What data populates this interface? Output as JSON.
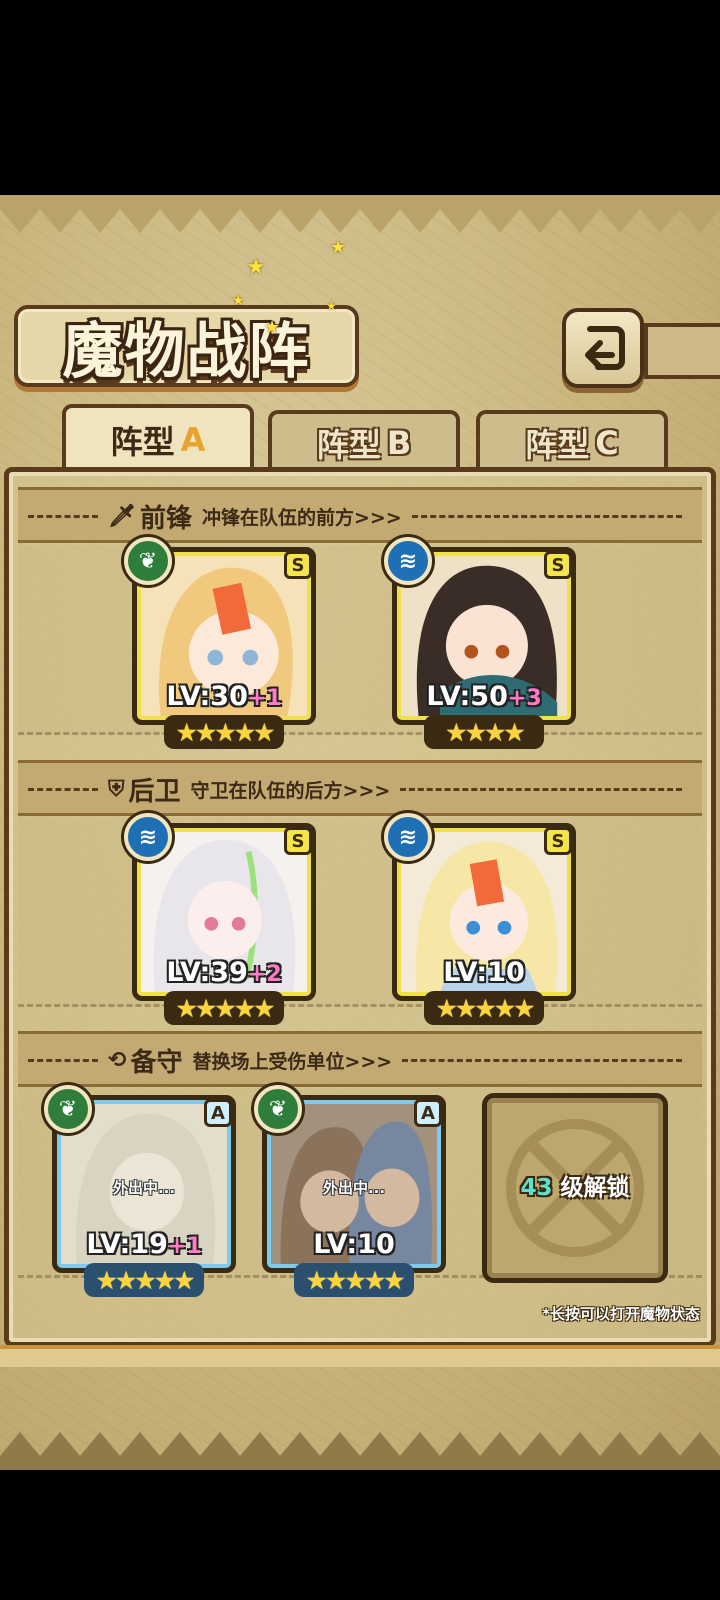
{
  "header": {
    "title": "魔物战阵"
  },
  "tabs": [
    {
      "label": "阵型",
      "letter": "A",
      "active": true
    },
    {
      "label": "阵型",
      "letter": "B",
      "active": false
    },
    {
      "label": "阵型",
      "letter": "C",
      "active": false
    }
  ],
  "sections": {
    "front": {
      "title": "前锋",
      "desc": "冲锋在队伍的前方>>>"
    },
    "rear": {
      "title": "后卫",
      "desc": "守卫在队伍的后方>>>"
    },
    "reserve": {
      "title": "备守",
      "desc": "替换场上受伤单位>>>"
    }
  },
  "front_units": [
    {
      "element": "leaf",
      "rank": "S",
      "level": "LV:30",
      "bonus": "+1",
      "stars": 5
    },
    {
      "element": "water",
      "rank": "S",
      "level": "LV:50",
      "bonus": "+3",
      "stars": 4
    }
  ],
  "rear_units": [
    {
      "element": "water",
      "rank": "S",
      "level": "LV:39",
      "bonus": "+2",
      "stars": 5
    },
    {
      "element": "water",
      "rank": "S",
      "level": "LV:10",
      "bonus": "",
      "stars": 5
    }
  ],
  "reserve_units": [
    {
      "element": "leaf",
      "rank": "A",
      "status": "外出中...",
      "level": "LV:19",
      "bonus": "+1",
      "stars": 5
    },
    {
      "element": "leaf",
      "rank": "A",
      "status": "外出中...",
      "level": "LV:10",
      "bonus": "",
      "stars": 5
    }
  ],
  "locked_slot": {
    "level": "43",
    "text": "级解锁"
  },
  "hint": "*长按可以打开魔物状态",
  "colors": {
    "panel": "#c9b57d",
    "frame_dark": "#3b2a12",
    "rank_s": "#f4e64a",
    "rank_a": "#cdeeff",
    "leaf": "#2f7d3a",
    "water": "#1f6fb5",
    "bonus": "#ff7bc8"
  }
}
